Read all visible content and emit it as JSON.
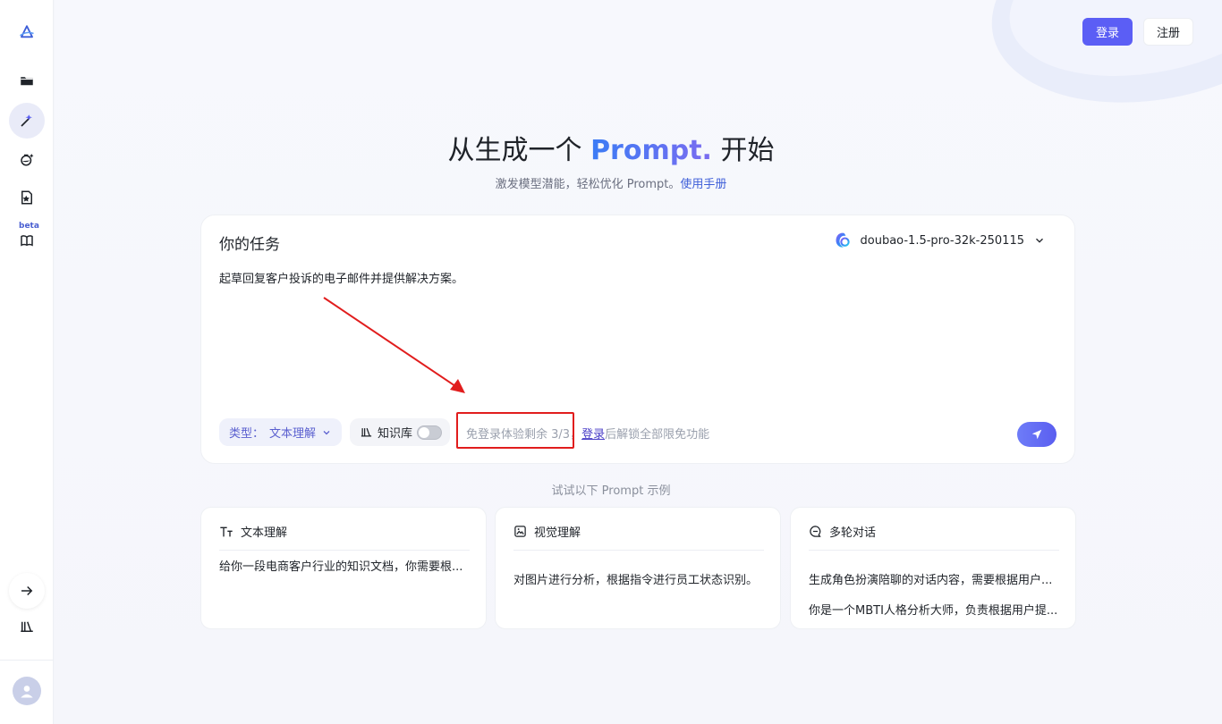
{
  "header": {
    "login_label": "登录",
    "register_label": "注册"
  },
  "sidebar": {
    "beta_label": "beta",
    "items": [
      {
        "icon": "logo-icon"
      },
      {
        "icon": "folder-icon"
      },
      {
        "icon": "magic-wand-icon"
      },
      {
        "icon": "flask-icon"
      },
      {
        "icon": "star-doc-icon"
      },
      {
        "icon": "book-icon"
      },
      {
        "icon": "arrow-right-icon"
      },
      {
        "icon": "library-icon"
      },
      {
        "icon": "user-avatar-icon"
      }
    ]
  },
  "hero": {
    "title_prefix": "从生成一个 ",
    "title_accent": "Prompt.",
    "title_suffix": " 开始",
    "subtitle": "激发模型潜能，轻松优化 Prompt。",
    "manual_link": "使用手册"
  },
  "task": {
    "title": "你的任务",
    "model": "doubao-1.5-pro-32k-250115",
    "text": "起草回复客户投诉的电子邮件并提供解决方案。",
    "type_label": "类型：",
    "type_value": "文本理解",
    "kb_label": "知识库",
    "trial_text": "免登录体验剩余 3/3，",
    "trial_link": "登录",
    "trial_suffix": "后解锁全部限免功能"
  },
  "examples": {
    "label": "试试以下 Prompt 示例",
    "cards": [
      {
        "title": "文本理解",
        "icon": "text-icon",
        "lines": [
          "给你一段电商客户行业的知识文档，你需要根..."
        ]
      },
      {
        "title": "视觉理解",
        "icon": "image-icon",
        "lines": [
          "对图片进行分析，根据指令进行员工状态识别。"
        ]
      },
      {
        "title": "多轮对话",
        "icon": "chat-icon",
        "lines": [
          "生成角色扮演陪聊的对话内容，需要根据用户...",
          "你是一个MBTI人格分析大师，负责根据用户提..."
        ]
      }
    ]
  },
  "colors": {
    "accent": "#5b5ef5",
    "highlight": "#e11d1d"
  }
}
